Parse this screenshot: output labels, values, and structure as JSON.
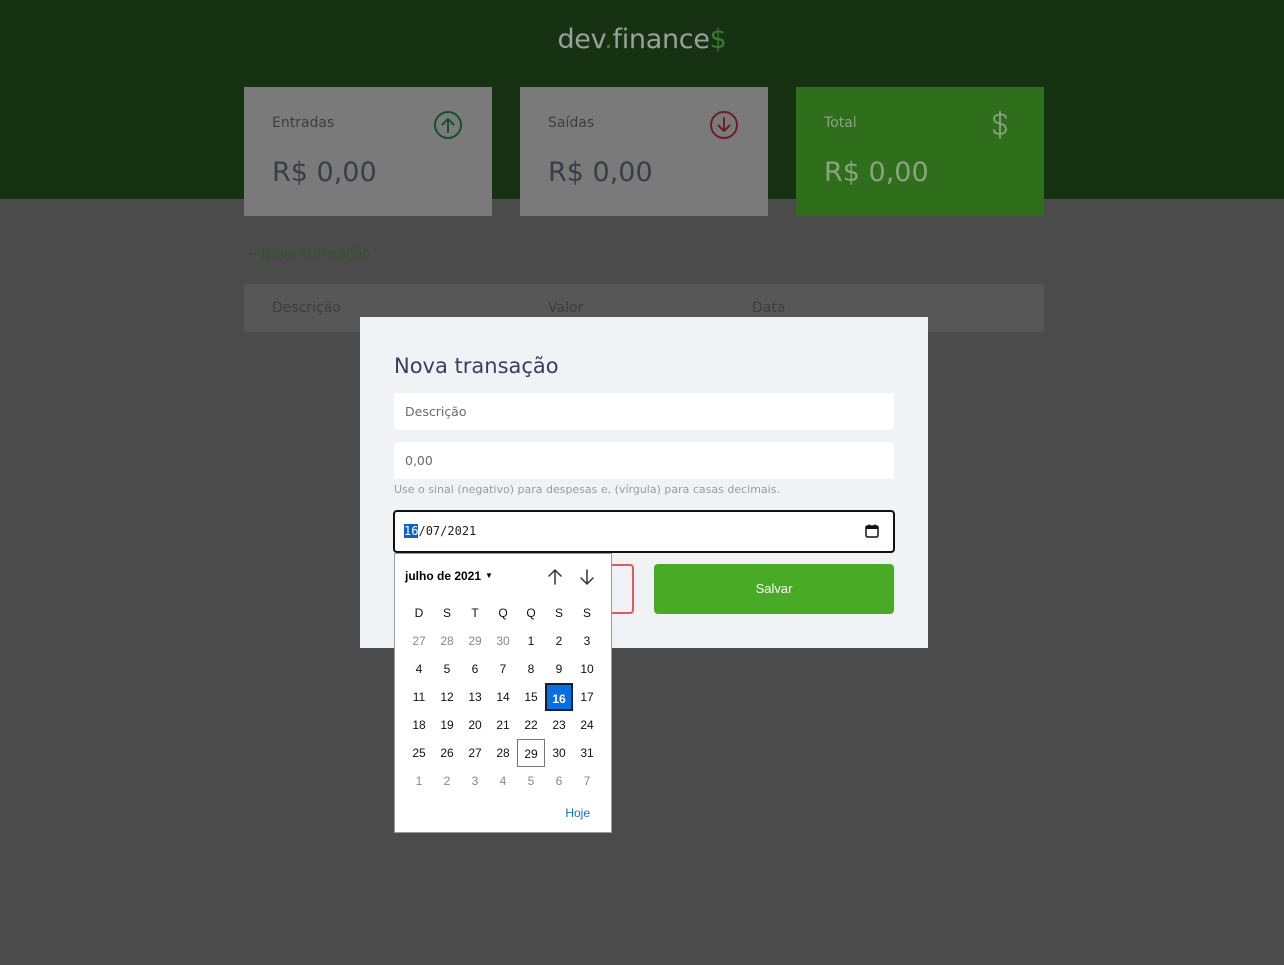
{
  "app": {
    "logo": {
      "part1": "dev",
      "dot": ".",
      "part2": "finance",
      "dollar": "$"
    }
  },
  "cards": [
    {
      "label": "Entradas",
      "value": "R$ 0,00",
      "icon": "arrow-up-circle-icon"
    },
    {
      "label": "Saídas",
      "value": "R$ 0,00",
      "icon": "arrow-down-circle-icon"
    },
    {
      "label": "Total",
      "value": "R$ 0,00",
      "icon": "dollar-icon"
    }
  ],
  "new_transaction_link": "+ Nova transação",
  "table": {
    "headers": [
      "Descrição",
      "Valor",
      "Data"
    ]
  },
  "modal": {
    "title": "Nova transação",
    "description_placeholder": "Descrição",
    "amount_placeholder": "0,00",
    "help_text": "Use o sinal (negativo) para despesas e, (vírgula) para casas decimais.",
    "date": {
      "day": "16",
      "month": "07",
      "year": "2021",
      "sep": "/"
    },
    "save_label": "Salvar"
  },
  "datepicker": {
    "month_label": "julho de 2021",
    "weekdays": [
      "D",
      "S",
      "T",
      "Q",
      "Q",
      "S",
      "S"
    ],
    "weeks": [
      [
        "27",
        "28",
        "29",
        "30",
        "1",
        "2",
        "3"
      ],
      [
        "4",
        "5",
        "6",
        "7",
        "8",
        "9",
        "10"
      ],
      [
        "11",
        "12",
        "13",
        "14",
        "15",
        "16",
        "17"
      ],
      [
        "18",
        "19",
        "20",
        "21",
        "22",
        "23",
        "24"
      ],
      [
        "25",
        "26",
        "27",
        "28",
        "29",
        "30",
        "31"
      ],
      [
        "1",
        "2",
        "3",
        "4",
        "5",
        "6",
        "7"
      ]
    ],
    "selected_day": "16",
    "today_day": "29",
    "today_label": "Hoje"
  },
  "colors": {
    "header_bg": "#173113",
    "accent_green": "#49aa26",
    "expense_red": "#e92929",
    "title_text": "#363f5f"
  }
}
